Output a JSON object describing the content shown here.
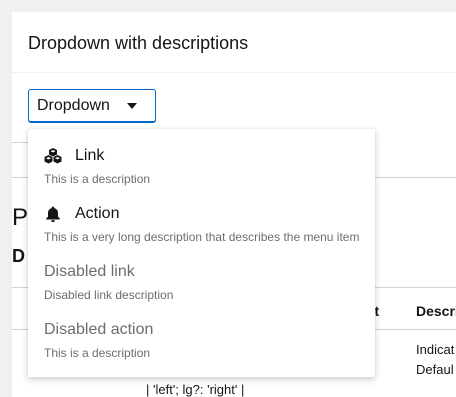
{
  "card": {
    "title": "Dropdown with descriptions"
  },
  "dropdown": {
    "toggle_label": "Dropdown",
    "items": [
      {
        "icon": "cubes-icon",
        "label": "Link",
        "description": "This is a description",
        "disabled": false
      },
      {
        "icon": "bell-icon",
        "label": "Action",
        "description": "This is a very long description that describes the menu item",
        "disabled": false
      },
      {
        "icon": "",
        "label": "Disabled link",
        "description": "Disabled link description",
        "disabled": true
      },
      {
        "icon": "",
        "label": "Disabled action",
        "description": "This is a description",
        "disabled": true
      }
    ]
  },
  "background": {
    "heading_partial": "P",
    "subheading_partial": "D",
    "table_header_default_partial": "ult",
    "table_header_description_partial": "Descri",
    "cell_line1_partial": "Indicat",
    "cell_line2_partial": "Defaul",
    "code_partial": "| 'left'; lg?: 'right' |"
  },
  "colors": {
    "accent": "#0066cc",
    "text": "#151515",
    "muted": "#6a6e73",
    "page_bg": "#f0f0f0"
  }
}
